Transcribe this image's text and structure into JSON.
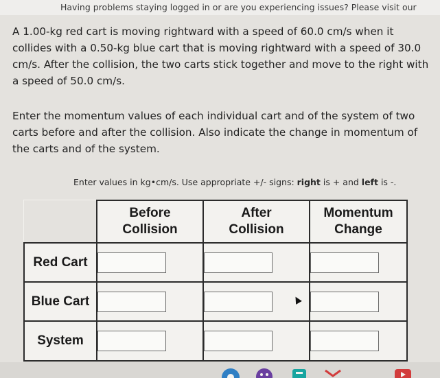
{
  "banner": {
    "text": "Having problems staying logged in or are you experiencing issues? Please visit our"
  },
  "problem": {
    "paragraph1": "A 1.00-kg red cart is moving rightward with a speed of 60.0 cm/s when it collides with a 0.50-kg blue cart that is moving rightward with a speed of 30.0 cm/s. After the collision, the two carts stick together and move to the right with a speed of 50.0 cm/s.",
    "paragraph2": "Enter the momentum values of each individual cart and of the system of two carts before and after the collision. Also indicate the change in momentum of the carts and of the system."
  },
  "instruction": {
    "prefix": "Enter values in kg•cm/s. Use appropriate +/- signs: ",
    "right_word": "right",
    "middle": " is + and ",
    "left_word": "left",
    "suffix": " is -."
  },
  "table": {
    "columns": [
      {
        "line1": "Before",
        "line2": "Collision"
      },
      {
        "line1": "After",
        "line2": "Collision"
      },
      {
        "line1": "Momentum",
        "line2": "Change"
      }
    ],
    "rows": [
      {
        "label": "Red Cart",
        "values": [
          "",
          "",
          ""
        ]
      },
      {
        "label": "Blue Cart",
        "values": [
          "",
          "",
          ""
        ]
      },
      {
        "label": "System",
        "values": [
          "",
          "",
          ""
        ]
      }
    ]
  },
  "colors": {
    "background": "#e4e2de",
    "table_border": "#2b2b2b",
    "taskbar_blue": "#2f7fc4",
    "taskbar_teal": "#18a5a0",
    "taskbar_purple": "#6a3fa0",
    "taskbar_red": "#d23c3c"
  },
  "icons": [
    "mouse-cursor-icon",
    "chrome-icon",
    "files-icon",
    "gmail-icon",
    "play-store-icon",
    "youtube-icon"
  ]
}
